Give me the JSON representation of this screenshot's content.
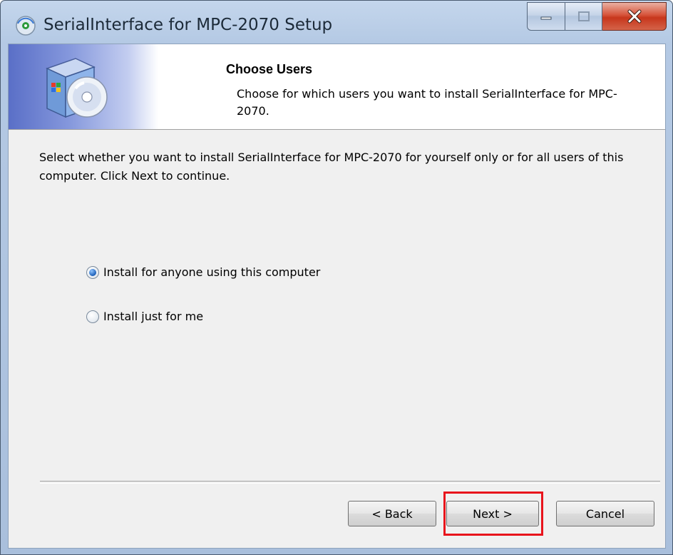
{
  "window": {
    "title": "SerialInterface for MPC-2070 Setup",
    "controls": [
      "minimize-icon",
      "maximize-icon",
      "close-icon"
    ]
  },
  "header": {
    "title": "Choose Users",
    "subtitle": "Choose for which users you want to install SerialInterface for MPC-2070."
  },
  "body": {
    "intro": "Select whether you want to install SerialInterface for MPC-2070 for yourself only or for all users of this computer. Click Next to continue.",
    "options": [
      {
        "label": "Install for anyone using this computer",
        "selected": true
      },
      {
        "label": "Install just for me",
        "selected": false
      }
    ]
  },
  "buttons": {
    "back": "< Back",
    "next": "Next >",
    "cancel": "Cancel"
  },
  "colors": {
    "highlight": "#e8141c",
    "close_button": "#c7361c"
  }
}
